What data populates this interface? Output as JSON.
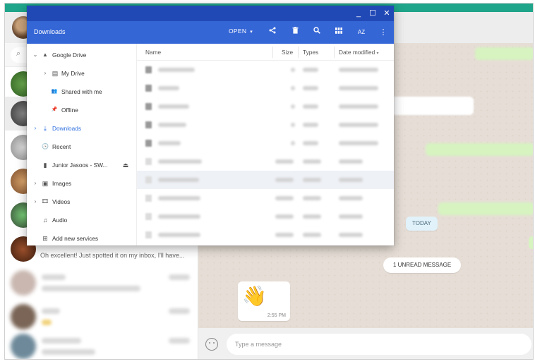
{
  "files_app": {
    "toolbar": {
      "title": "Downloads",
      "open_label": "OPEN",
      "open_caret": "▾",
      "icons": [
        "share-icon",
        "delete-icon",
        "search-icon",
        "grid-view-icon",
        "sort-icon",
        "more-vert-icon"
      ],
      "sort_label": "AZ"
    },
    "window_controls": {
      "minimize": "_",
      "maximize": "☐",
      "close": "✕"
    },
    "nav": [
      {
        "label": "Google Drive",
        "icon": "google-drive-icon",
        "glyph": "▲",
        "chevron": "⌄",
        "active": false
      },
      {
        "label": "My Drive",
        "icon": "my-drive-icon",
        "glyph": "▤",
        "chevron": "›",
        "active": false
      },
      {
        "label": "Shared with me",
        "icon": "shared-icon",
        "glyph": "👥",
        "chevron": "",
        "active": false
      },
      {
        "label": "Offline",
        "icon": "pin-icon",
        "glyph": "📌",
        "chevron": "",
        "active": false
      },
      {
        "label": "Downloads",
        "icon": "download-icon",
        "glyph": "⤓",
        "chevron": "›",
        "active": true
      },
      {
        "label": "Recent",
        "icon": "clock-icon",
        "glyph": "🕓",
        "chevron": "",
        "active": false
      },
      {
        "label": "Junior Jasoos - SW...",
        "icon": "usb-drive-icon",
        "glyph": "▮",
        "chevron": "",
        "eject": "⏏",
        "active": false
      },
      {
        "label": "Images",
        "icon": "image-icon",
        "glyph": "▣",
        "chevron": "›",
        "active": false
      },
      {
        "label": "Videos",
        "icon": "video-icon",
        "glyph": "🎞",
        "chevron": "›",
        "active": false
      },
      {
        "label": "Audio",
        "icon": "audio-icon",
        "glyph": "♫",
        "chevron": "",
        "active": false
      },
      {
        "label": "Add new services",
        "icon": "add-box-icon",
        "glyph": "⊞",
        "chevron": "",
        "active": false
      }
    ],
    "columns": {
      "name": "Name",
      "size": "Size",
      "types": "Types",
      "date_modified": "Date modified",
      "sort_indicator": "▾"
    }
  },
  "whatsapp": {
    "chat_preview": "Oh excellent! Just spotted it on my inbox, I'll have...",
    "day_label": "TODAY",
    "unread_label": "1 UNREAD MESSAGE",
    "message_emoji": "👋",
    "message_time": "2:55 PM",
    "composer_placeholder": "Type a message",
    "accent_color": "#1fa58a"
  }
}
